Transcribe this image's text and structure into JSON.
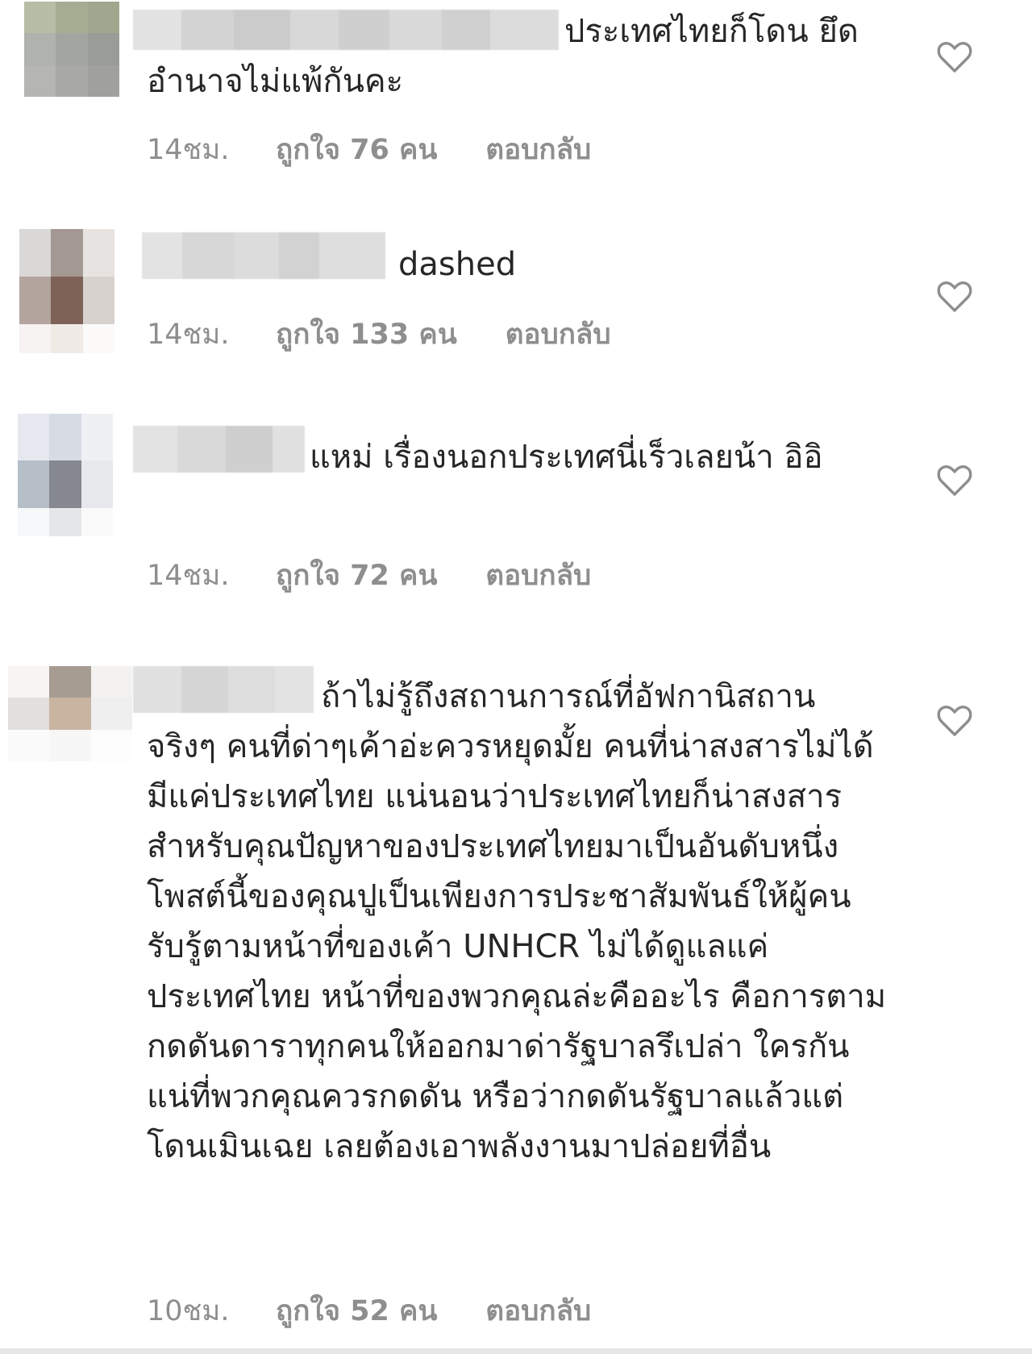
{
  "comments": [
    {
      "text": "ประเทศไทยก็โดน ยึดอำนาจไม่แพ้กันคะ",
      "time": "14ชม.",
      "likes": "ถูกใจ 76 คน",
      "reply": "ตอบกลับ",
      "like_icon": "heart-outline"
    },
    {
      "text": "dashed",
      "time": "14ชม.",
      "likes": "ถูกใจ 133 คน",
      "reply": "ตอบกลับ",
      "like_icon": "heart-outline"
    },
    {
      "text": "แหม่ เรื่องนอกประเทศนี่เร็วเลยน้า อิอิ",
      "time": "14ชม.",
      "likes": "ถูกใจ 72 คน",
      "reply": "ตอบกลับ",
      "like_icon": "heart-outline"
    },
    {
      "text": "ถ้าไม่รู้ถึงสถานการณ์ที่อัฟกานิสถาน จริงๆ คนที่ด่าๆเค้าอ่ะควรหยุดมั้ย คนที่น่าสงสารไม่ได้มีแค่ประเทศไทย แน่นอนว่าประเทศไทยก็น่าสงสาร สำหรับคุณปัญหาของประเทศไทยมาเป็นอันดับหนึ่ง โพสต์นี้ของคุณปูเป็นเพียงการประชาสัมพันธ์ให้ผู้คนรับรู้ตามหน้าที่ของเค้า UNHCR ไม่ได้ดูแลแค่ประเทศไทย หน้าที่ของพวกคุณล่ะคืออะไร คือการตามกดดันดาราทุกคนให้ออกมาด่ารัฐบาลรึเปล่า ใครกันแน่ที่พวกคุณควรกดดัน หรือว่ากดดันรัฐบาลแล้วแต่โดนเมินเฉย เลยต้องเอาพลังงานมาปล่อยที่อื่น",
      "time": "10ชม.",
      "likes": "ถูกใจ 52 คน",
      "reply": "ตอบกลับ",
      "like_icon": "heart-outline"
    }
  ],
  "colors": {
    "text": "#262626",
    "meta": "#8e8e8e",
    "heart_stroke": "#8e8e8e"
  }
}
